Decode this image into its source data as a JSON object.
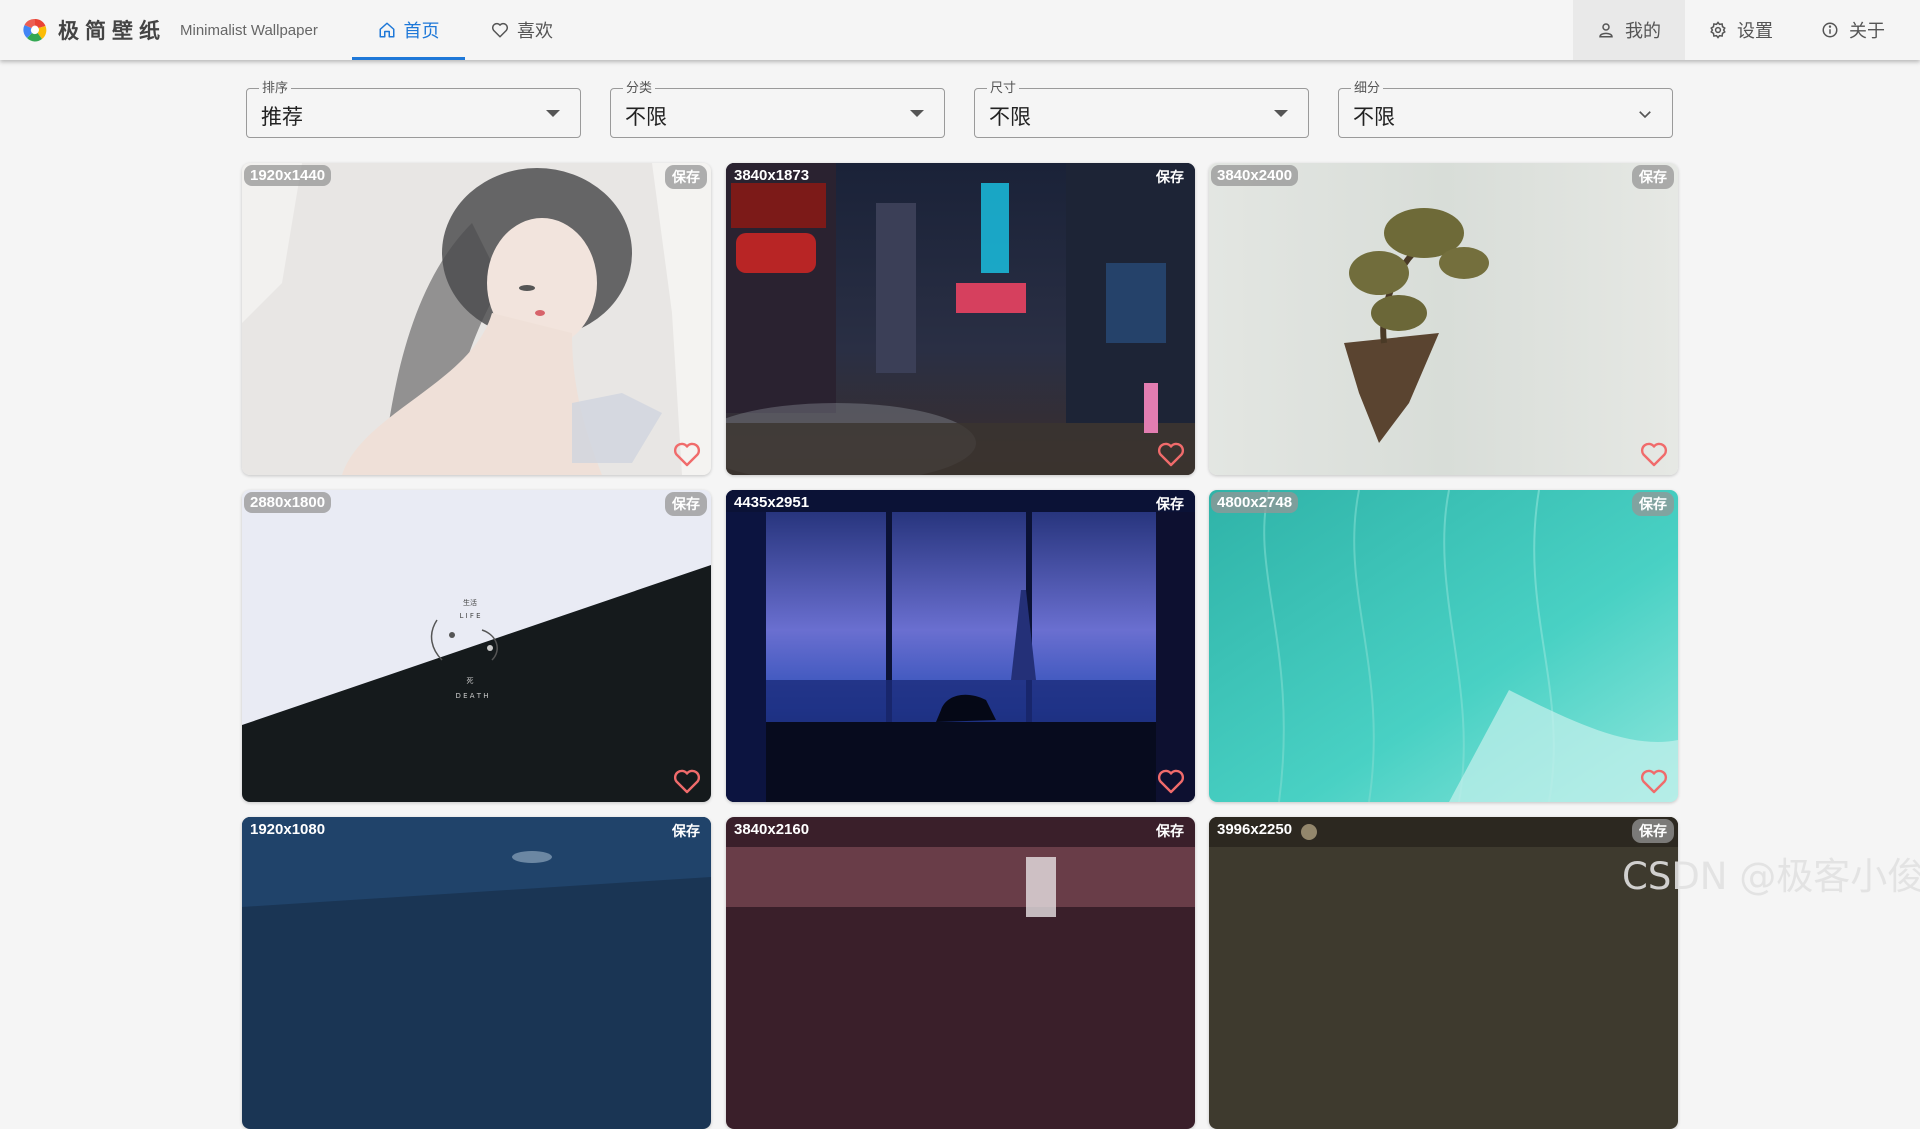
{
  "app": {
    "name": "极简壁纸",
    "subtitle": "Minimalist Wallpaper",
    "icon": "pinwheel-logo-icon"
  },
  "nav": {
    "tabs": [
      {
        "label": "首页",
        "icon": "home-icon",
        "active": true
      },
      {
        "label": "喜欢",
        "icon": "heart-outline-icon",
        "active": false
      }
    ],
    "accent_color": "#1e78d8"
  },
  "menu": {
    "mine": {
      "label": "我的",
      "icon": "user-icon"
    },
    "settings": {
      "label": "设置",
      "icon": "gear-icon"
    },
    "about": {
      "label": "关于",
      "icon": "info-icon"
    }
  },
  "filters": {
    "sort": {
      "label": "排序",
      "value": "推荐"
    },
    "category": {
      "label": "分类",
      "value": "不限"
    },
    "size": {
      "label": "尺寸",
      "value": "不限"
    },
    "sub": {
      "label": "细分",
      "value": "不限"
    }
  },
  "cards": [
    {
      "resolution": "1920x1440",
      "save_label": "保存",
      "theme": "watercolor-girl",
      "liked": false
    },
    {
      "resolution": "3840x1873",
      "save_label": "保存",
      "theme": "neon-city-street",
      "liked": false
    },
    {
      "resolution": "3840x2400",
      "save_label": "保存",
      "theme": "floating-island-tree",
      "liked": false
    },
    {
      "resolution": "2880x1800",
      "save_label": "保存",
      "theme": "life-death-diagonal",
      "liked": false,
      "art_text": {
        "top_cn": "生活",
        "top": "L I F E",
        "bottom_cn": "死",
        "bottom": "D E A T H"
      }
    },
    {
      "resolution": "4435x2951",
      "save_label": "保存",
      "theme": "night-window-paris",
      "liked": false
    },
    {
      "resolution": "4800x2748",
      "save_label": "保存",
      "theme": "turquoise-ocean",
      "liked": false
    },
    {
      "resolution": "1920x1080",
      "save_label": "保存",
      "theme": "night-town",
      "liked": false
    },
    {
      "resolution": "3840x2160",
      "save_label": "保存",
      "theme": "pink-city",
      "liked": false
    },
    {
      "resolution": "3996x2250",
      "save_label": "保存",
      "theme": "dark-room",
      "liked": false
    }
  ],
  "colors": {
    "heart": "#f06b6b",
    "background": "#f5f5f5"
  },
  "watermark": "CSDN @极客小俊"
}
